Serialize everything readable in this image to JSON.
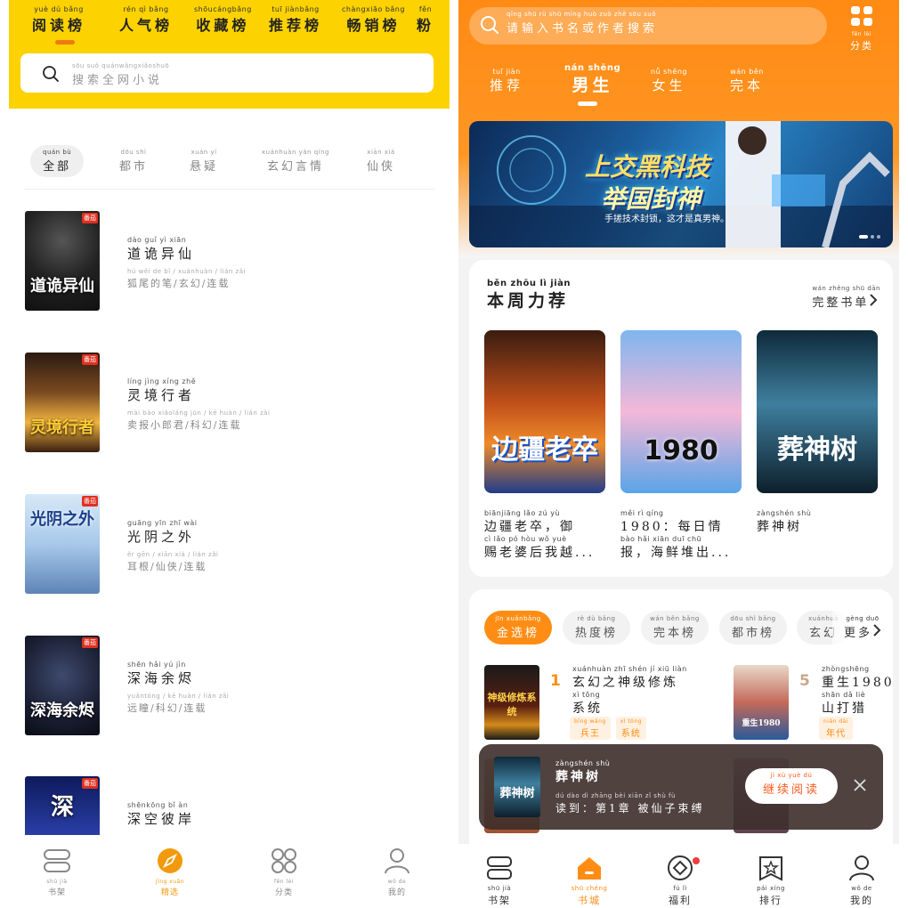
{
  "left": {
    "tabs": [
      {
        "py": "yuè dú bǎng",
        "label": "阅读榜"
      },
      {
        "py": "rén qì bǎng",
        "label": "人气榜"
      },
      {
        "py": "shōucángbǎng",
        "label": "收藏榜"
      },
      {
        "py": "tuī jiànbǎng",
        "label": "推荐榜"
      },
      {
        "py": "chàngxiāo bǎng",
        "label": "畅销榜"
      },
      {
        "py": "fěn",
        "label": "粉"
      }
    ],
    "search": {
      "py": "sōu suǒ quánwǎngxiǎoshuō",
      "placeholder": "搜索全网小说"
    },
    "categories": [
      {
        "py": "quán bù",
        "label": "全部"
      },
      {
        "py": "dōu shì",
        "label": "都市"
      },
      {
        "py": "xuán yí",
        "label": "悬疑"
      },
      {
        "py": "xuánhuàn yán qíng",
        "label": "玄幻言情"
      },
      {
        "py": "xiān xiá",
        "label": "仙侠"
      }
    ],
    "books": [
      {
        "title_py": "dào guǐ yì xiān",
        "title": "道诡异仙",
        "meta_py": "hú wěi de bǐ  /  xuánhuàn  /  lián zǎi",
        "meta": "狐尾的笔/玄幻/连载",
        "cover_text": "道诡异仙",
        "badge": "番茄"
      },
      {
        "title_py": "líng jìng xíng zhě",
        "title": "灵境行者",
        "meta_py": "mài bào xiǎoláng jūn  /  kē huàn  /  lián zǎi",
        "meta": "卖报小郎君/科幻/连载",
        "cover_text": "灵境行者",
        "badge": "番茄"
      },
      {
        "title_py": "guāng yīn zhī wài",
        "title": "光阴之外",
        "meta_py": "ěr gēn  /  xiān xiá  /  lián zǎi",
        "meta": "耳根/仙侠/连载",
        "cover_text": "光阴之外",
        "badge": "番茄"
      },
      {
        "title_py": "shēn hǎi yú jìn",
        "title": "深海余烬",
        "meta_py": "yuǎntóng  /  kē huàn  /  lián zǎi",
        "meta": "远瞳/科幻/连载",
        "cover_text": "深海余烬",
        "badge": "番茄"
      },
      {
        "title_py": "shēnkōng bǐ àn",
        "title": "深空彼岸",
        "meta_py": "",
        "meta": "",
        "cover_text": "深",
        "badge": "番茄"
      }
    ],
    "nav": [
      {
        "py": "shū jià",
        "label": "书架",
        "icon": "bookshelf-icon"
      },
      {
        "py": "jīng xuǎn",
        "label": "精选",
        "icon": "compass-icon"
      },
      {
        "py": "fēn lèi",
        "label": "分类",
        "icon": "category-icon"
      },
      {
        "py": "wǒ de",
        "label": "我的",
        "icon": "user-icon"
      }
    ]
  },
  "right": {
    "search": {
      "py": "qǐng shū rù shū míng huò zuò zhě sōu suǒ",
      "placeholder": "请输入书名或作者搜索"
    },
    "category_btn": {
      "py": "fēn lèi",
      "label": "分类"
    },
    "tabs": [
      {
        "py": "tuī jiàn",
        "label": "推荐"
      },
      {
        "py": "nán shēng",
        "label": "男生"
      },
      {
        "py": "nǚ shēng",
        "label": "女生"
      },
      {
        "py": "wán běn",
        "label": "完本"
      }
    ],
    "banner": {
      "line1": "上交黑科技",
      "line2": "举国封神",
      "sub": "手搓技术封锁，这才是真男神。"
    },
    "weekly": {
      "title_py": "běn zhōu  lì  jiàn",
      "title": "本周力荐",
      "more_py": "wán zhěng shū dān",
      "more": "完整书单",
      "books": [
        {
          "cover_text": "边疆老卒",
          "l1py": "biānjiāng lǎo  zú     yù",
          "l1": "边疆老卒，御",
          "l2py": "cì  lǎo  pó  hòu  wǒ  yuè",
          "l2": "赐老婆后我越..."
        },
        {
          "cover_text": "1980",
          "l1py": "         měi  rì  qíng",
          "l1": "1980：每日情",
          "l2py": "bào      hǎi xiān duī chū",
          "l2": "报，海鲜堆出..."
        },
        {
          "cover_text": "葬神树",
          "l1py": "zàngshén shù",
          "l1": "葬神树",
          "l2py": "",
          "l2": ""
        }
      ]
    },
    "rank_tabs": [
      {
        "py": "jīn xuǎnbǎng",
        "label": "金选榜"
      },
      {
        "py": "rè  dù bǎng",
        "label": "热度榜"
      },
      {
        "py": "wán běn bǎng",
        "label": "完本榜"
      },
      {
        "py": "dōu shì bǎng",
        "label": "都市榜"
      },
      {
        "py": "xuánhuà",
        "label": "玄幻"
      },
      {
        "py": "gèng duō",
        "label": "更多"
      }
    ],
    "rank_items": [
      {
        "num": "1",
        "l1py": "xuánhuàn zhī shén  jí  xiū liàn",
        "l1": "玄幻之神级修炼",
        "l2py": "xì tǒng",
        "l2": "系统",
        "cover_text": "神级修炼系统",
        "tags": [
          {
            "py": "bīng wáng",
            "label": "兵王"
          },
          {
            "py": "xì tǒng",
            "label": "系统"
          }
        ]
      },
      {
        "num": "5",
        "l1py": "zhòngshēng",
        "l1": "重生1980",
        "l2py": "shān dǎ  liè",
        "l2": "山打猎",
        "cover_text": "重生1980",
        "tags": [
          {
            "py": "nián dài",
            "label": "年代"
          }
        ]
      }
    ],
    "popup": {
      "title_py": "zàngshén shù",
      "title": "葬神树",
      "progress_py": "dú dào     dì   zhāng bèi xiān  zǐ  shù  fù",
      "progress": "读到：第1章 被仙子束缚",
      "cont_py": "jì  xù  yuè  dú",
      "cont": "继续阅读"
    },
    "nav": [
      {
        "py": "shū jià",
        "label": "书架",
        "icon": "bookshelf-icon"
      },
      {
        "py": "shū chéng",
        "label": "书城",
        "icon": "home-icon"
      },
      {
        "py": "fú  lì",
        "label": "福利",
        "icon": "welfare-icon"
      },
      {
        "py": "pái xíng",
        "label": "排行",
        "icon": "rank-icon"
      },
      {
        "py": "wǒ  de",
        "label": "我的",
        "icon": "user-icon"
      }
    ]
  }
}
